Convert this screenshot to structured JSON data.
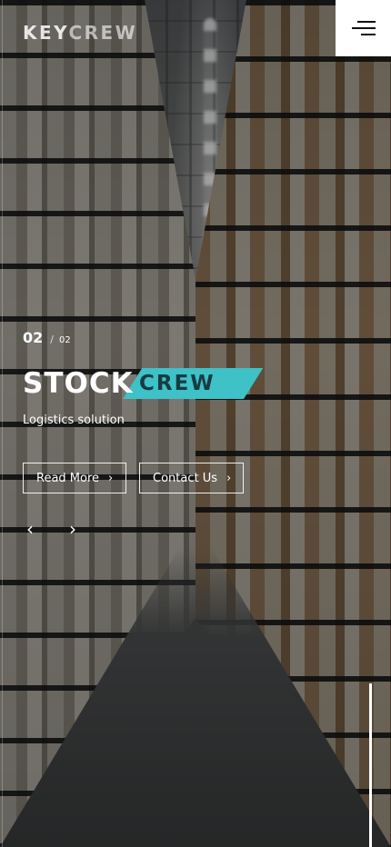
{
  "header": {
    "logo": {
      "text_part1": "KEY",
      "text_part2": "CREW"
    },
    "menu_icon": "hamburger-menu-icon"
  },
  "slide": {
    "current": "02",
    "separator": "/",
    "total": "02",
    "brand": {
      "word1": "STOCK",
      "word2": "CREW",
      "accent_color": "#3ec1c7"
    },
    "tagline": "Logistics solution",
    "buttons": {
      "read_more": "Read More",
      "contact_us": "Contact Us"
    },
    "nav": {
      "prev_icon": "chevron-left-icon",
      "next_icon": "chevron-right-icon"
    },
    "progress": 1.0
  },
  "colors": {
    "menu_bg": "#ffffff",
    "text": "#ffffff",
    "brand_accent": "#3ec1c7"
  }
}
